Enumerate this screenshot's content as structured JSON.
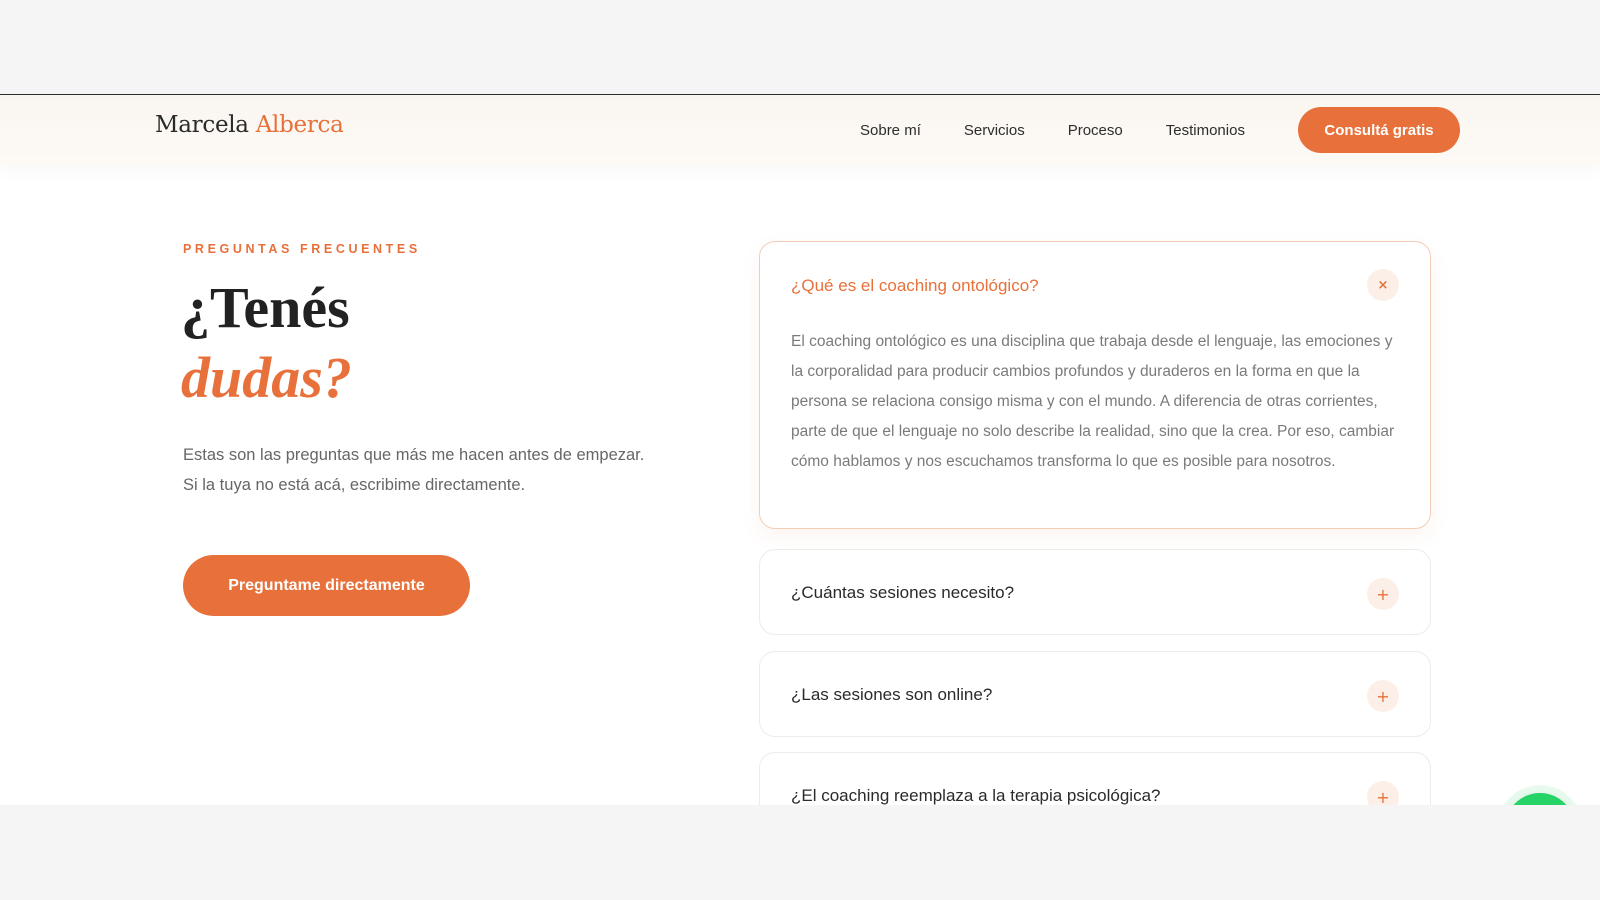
{
  "brand": {
    "first": "Marcela",
    "last": "Alberca"
  },
  "nav": {
    "items": [
      "Sobre mí",
      "Servicios",
      "Proceso",
      "Testimonios"
    ],
    "cta": "Consultá gratis"
  },
  "hero": {
    "eyebrow": "PREGUNTAS FRECUENTES",
    "title_line1": "¿Tenés",
    "title_line2": "dudas?",
    "intro_line1": "Estas son las preguntas que más me hacen antes de empezar.",
    "intro_line2": "Si la tuya no está acá, escribime directamente.",
    "cta": "Preguntame directamente"
  },
  "faq": [
    {
      "question": "¿Qué es el coaching ontológico?",
      "answer": "El coaching ontológico es una disciplina que trabaja desde el lenguaje, las emociones y la corporalidad para producir cambios profundos y duraderos en la forma en que la persona se relaciona consigo misma y con el mundo. A diferencia de otras corrientes, parte de que el lenguaje no solo describe la realidad, sino que la crea. Por eso, cambiar cómo hablamos y nos escuchamos transforma lo que es posible para nosotros.",
      "toggle": "×"
    },
    {
      "question": "¿Cuántas sesiones necesito?",
      "toggle": "+"
    },
    {
      "question": "¿Las sesiones son online?",
      "toggle": "+"
    },
    {
      "question": "¿El coaching reemplaza a la terapia psicológica?",
      "toggle": "+"
    }
  ],
  "icons": {
    "whatsapp": "whatsapp-icon"
  },
  "colors": {
    "accent": "#e8703a",
    "whatsapp": "#25d366"
  }
}
